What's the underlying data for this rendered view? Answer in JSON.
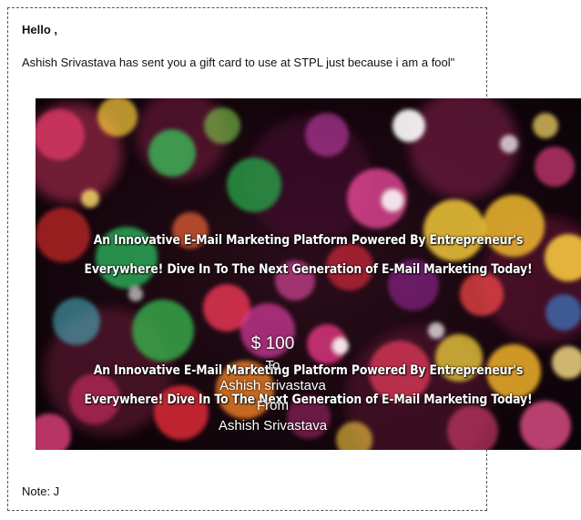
{
  "email": {
    "greeting": "Hello ,",
    "message": "Ashish Srivastava has sent you a gift card to use at STPL just because i am a fool\"",
    "note": "Note: J"
  },
  "gift_card": {
    "promo_top": {
      "line1": "An Innovative E-Mail Marketing Platform Powered By Entrepreneur's",
      "line2": "Everywhere! Dive In To The Next Generation of E-Mail Marketing Today!"
    },
    "promo_bottom": {
      "line1": "An Innovative E-Mail Marketing Platform Powered By Entrepreneur's",
      "line2": "Everywhere! Dive In To The Next Generation of E-Mail Marketing Today!"
    },
    "amount": "$ 100",
    "to_label": "To",
    "to_name": "Ashish srivastava",
    "from_label": "From",
    "from_name": "Ashish Srivastava",
    "background": "colorful-bokeh-lights",
    "colors": {
      "text": "#ffffff",
      "background_dark": "#12050b"
    }
  }
}
